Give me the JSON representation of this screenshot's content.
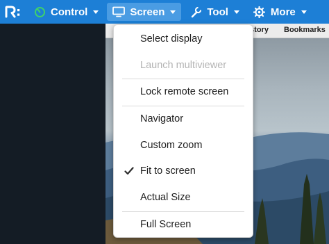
{
  "toolbar": {
    "logo_icon": "remote-desktop-logo-icon",
    "items": [
      {
        "label": "Control",
        "icon": "control-icon"
      },
      {
        "label": "Screen",
        "icon": "monitor-icon"
      },
      {
        "label": "Tool",
        "icon": "wrench-icon"
      },
      {
        "label": "More",
        "icon": "gear-icon"
      }
    ],
    "bg_color": "#1d7fd6",
    "active_color": "#4a9ce3"
  },
  "browser": {
    "history_label": "istory",
    "bookmarks_label": "Bookmarks"
  },
  "menu": {
    "items": [
      {
        "label": "Select display",
        "state": "normal"
      },
      {
        "label": "Launch multiviewer",
        "state": "disabled"
      },
      {
        "label": "Lock remote screen",
        "state": "normal"
      },
      {
        "label": "Navigator",
        "state": "normal"
      },
      {
        "label": "Custom zoom",
        "state": "normal"
      },
      {
        "label": "Fit to screen",
        "state": "checked"
      },
      {
        "label": "Actual Size",
        "state": "normal"
      },
      {
        "label": "Full Screen",
        "state": "normal"
      }
    ],
    "check_icon": "checkmark-icon"
  }
}
